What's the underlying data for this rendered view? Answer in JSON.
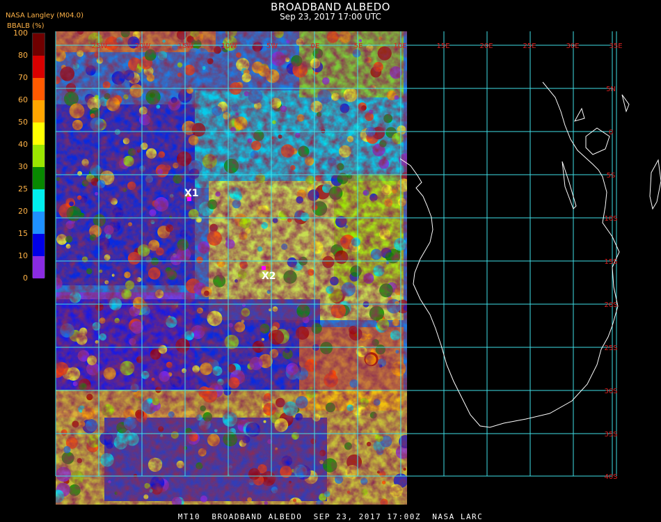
{
  "header": {
    "title": "BROADBAND ALBEDO",
    "subtitle": "Sep 23, 2017 17:00 UTC",
    "source": "NASA Langley (M04.0)"
  },
  "colorbar": {
    "label": "BBALB (%)",
    "ticks": [
      "100",
      "80",
      "70",
      "60",
      "50",
      "40",
      "30",
      "25",
      "20",
      "15",
      "10",
      "0"
    ],
    "colors": [
      "#700000",
      "#d80000",
      "#ff5a00",
      "#ffa500",
      "#ffff00",
      "#9be600",
      "#088800",
      "#00eeee",
      "#1e90ff",
      "#0000e6",
      "#8a2be2"
    ]
  },
  "map": {
    "lon_labels": [
      "35W",
      "30W",
      "25W",
      "20W",
      "15W",
      "10W",
      "5W",
      "0E",
      "5E",
      "10E",
      "15E",
      "20E",
      "25E",
      "30E",
      "35E"
    ],
    "lat_labels": [
      "5N",
      "0",
      "5S",
      "10S",
      "15S",
      "20S",
      "25S",
      "30S",
      "35S",
      "40S"
    ],
    "grid_color": "#40e0e8",
    "label_color": "#dc2020",
    "coast_color": "#ffffff"
  },
  "markers": [
    {
      "label": "X1",
      "color": "#ff00ff"
    },
    {
      "label": "X2",
      "color": "#ff00ff"
    }
  ],
  "footer": "MT10  BROADBAND ALBEDO  SEP 23, 2017 17:00Z  NASA LARC"
}
